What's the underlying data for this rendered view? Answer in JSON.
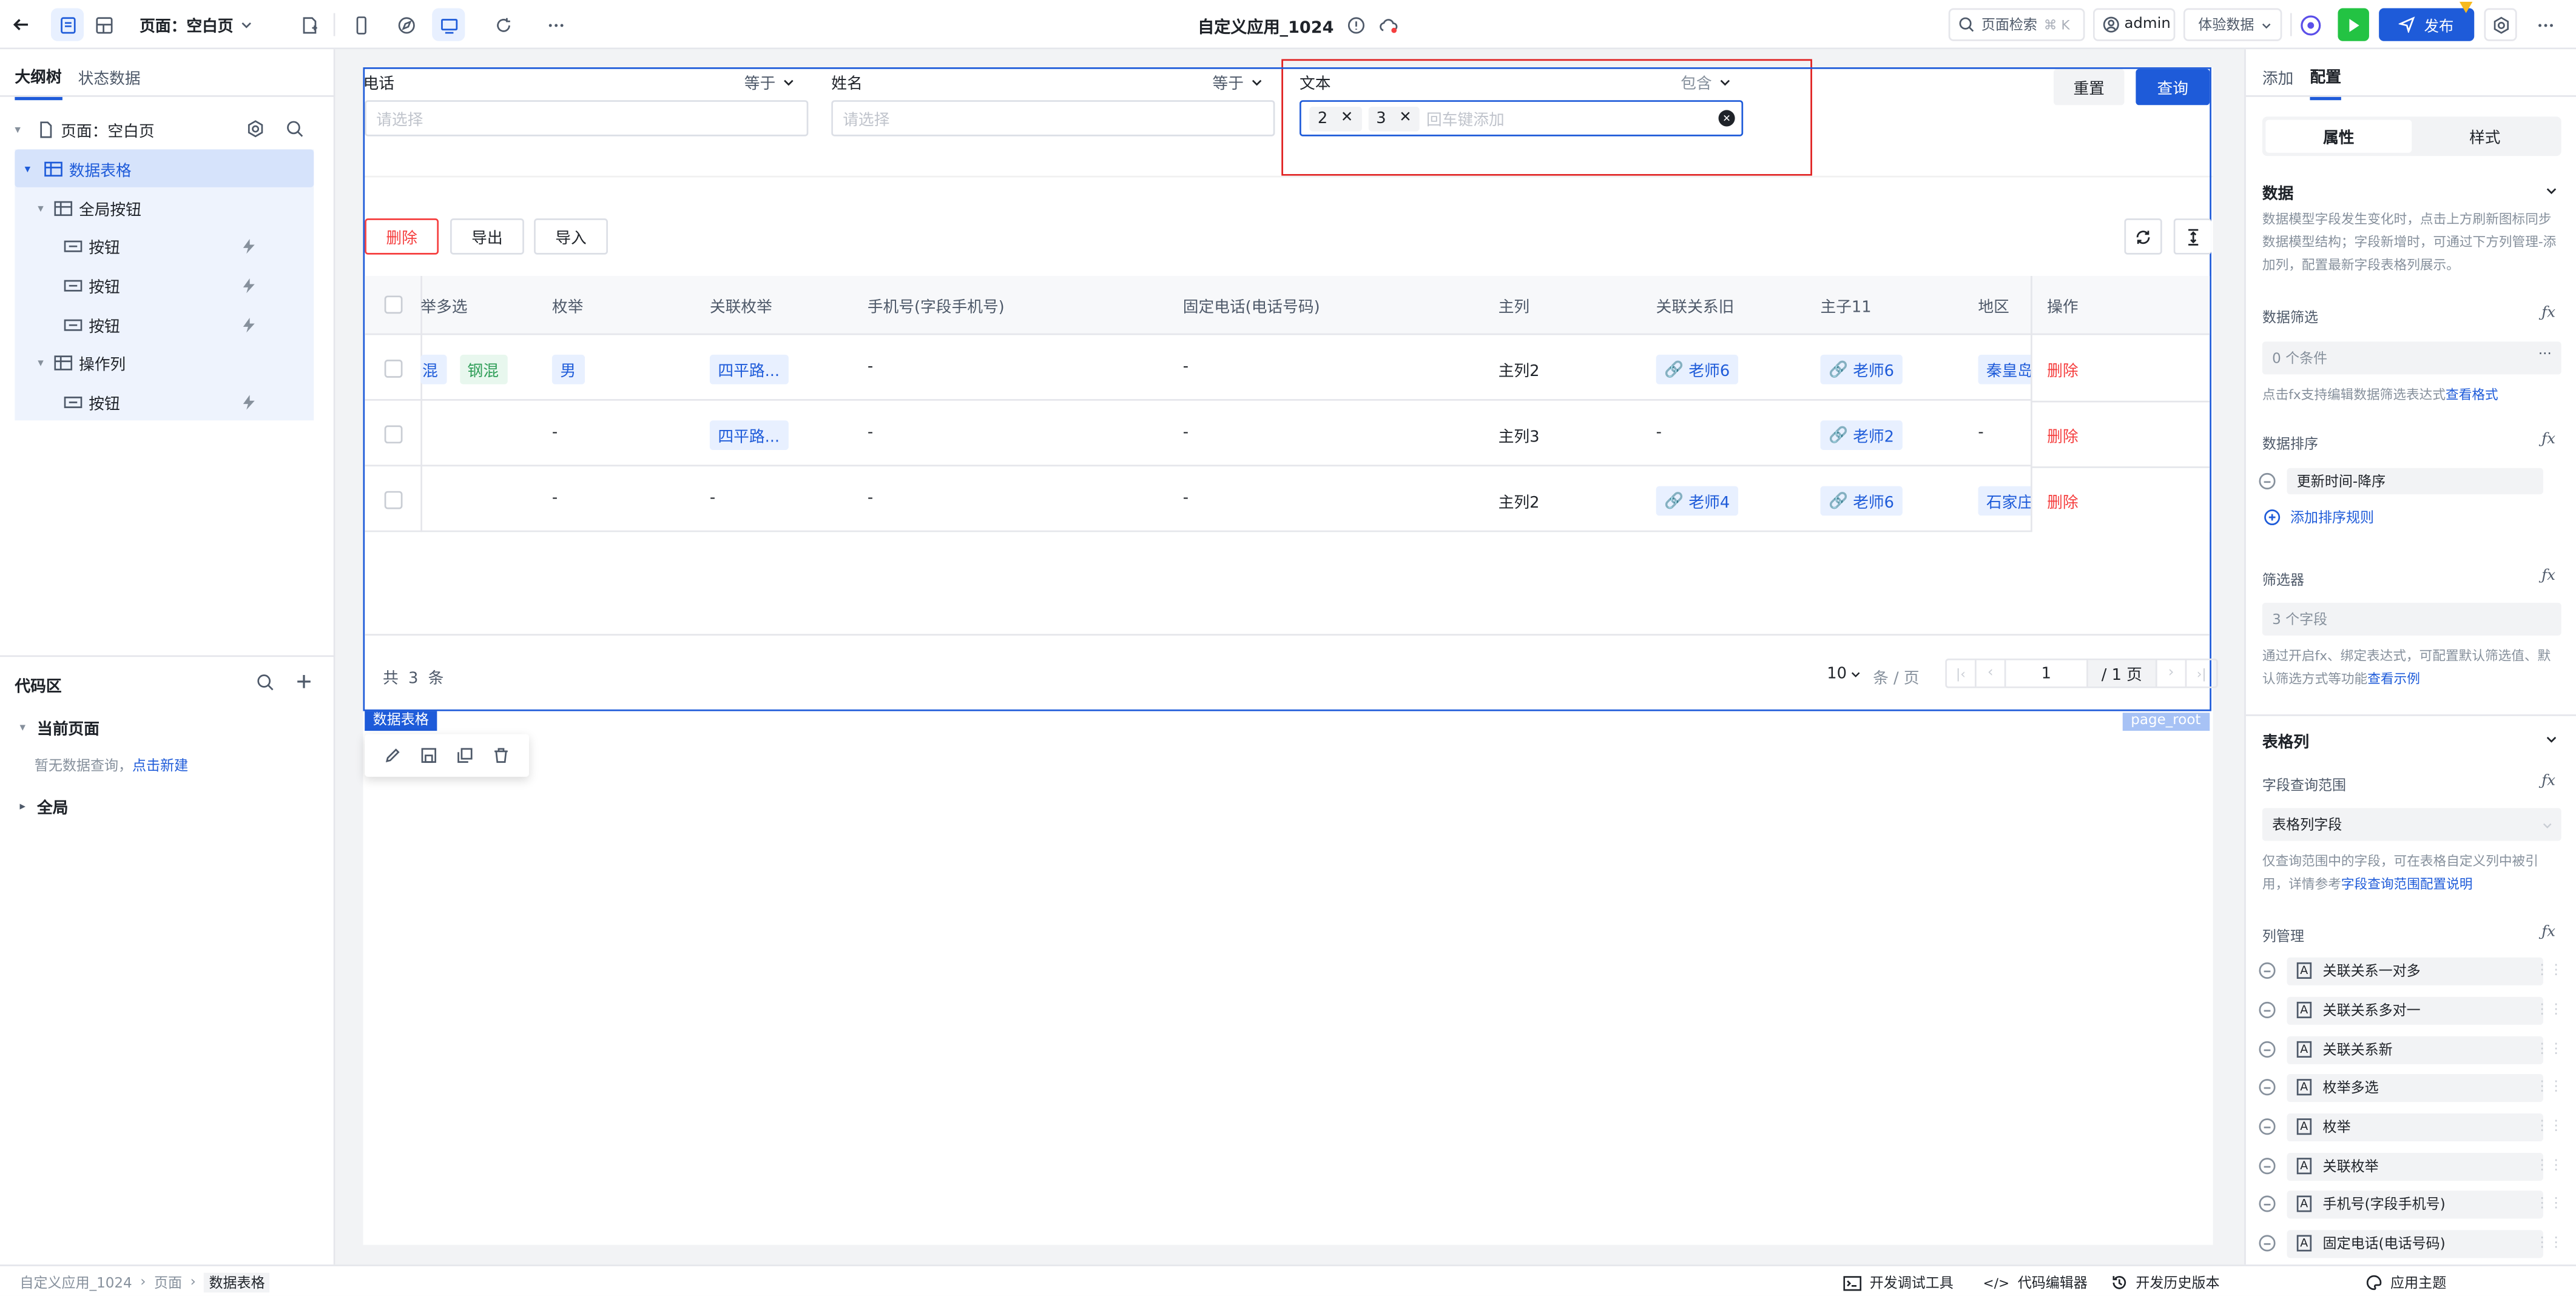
{
  "topbar": {
    "page_selector": "页面：空白页",
    "app_title": "自定义应用_1024",
    "search_label": "页面检索",
    "search_shortcut": "⌘ K",
    "user": "admin",
    "data_mode": "体验数据",
    "publish": "发布"
  },
  "left": {
    "tabs": [
      "大纲树",
      "状态数据"
    ],
    "tree": [
      {
        "label": "页面：空白页"
      },
      {
        "label": "数据表格"
      },
      {
        "label": "全局按钮"
      },
      {
        "label": "按钮"
      },
      {
        "label": "按钮"
      },
      {
        "label": "按钮"
      },
      {
        "label": "操作列"
      },
      {
        "label": "按钮"
      }
    ],
    "code_title": "代码区",
    "current_page": "当前页面",
    "no_query": "暂无数据查询，",
    "create_new": "点击新建",
    "global": "全局"
  },
  "filters": [
    {
      "label": "电话",
      "op": "等于",
      "placeholder": "请选择"
    },
    {
      "label": "姓名",
      "op": "等于",
      "placeholder": "请选择"
    },
    {
      "label": "文本",
      "op": "包含",
      "tags": [
        "2",
        "3"
      ],
      "placeholder": "回车键添加"
    }
  ],
  "actions": {
    "reset": "重置",
    "query": "查询",
    "delete": "删除",
    "export": "导出",
    "import": "导入"
  },
  "table": {
    "headers": [
      "举多选",
      "枚举",
      "关联枚举",
      "手机号(字段手机号)",
      "固定电话(电话号码)",
      "主列",
      "关联关系旧",
      "主子11",
      "地区",
      "操作"
    ],
    "rows": [
      {
        "multi": [
          "混",
          "钢混"
        ],
        "enum": "男",
        "rel_enum": "四平路...",
        "phone": "-",
        "tel": "-",
        "main": "主列2",
        "rel_old": "老师6",
        "sub11": "老师6",
        "region": "秦皇岛",
        "op": "删除"
      },
      {
        "multi": [],
        "enum": "-",
        "rel_enum": "四平路...",
        "phone": "-",
        "tel": "-",
        "main": "主列3",
        "rel_old": "-",
        "sub11": "老师2",
        "region": "-",
        "op": "删除"
      },
      {
        "multi": [],
        "enum": "-",
        "rel_enum": "-",
        "phone": "-",
        "tel": "-",
        "main": "主列2",
        "rel_old": "老师4",
        "sub11": "老师6",
        "region": "石家庄",
        "op": "删除"
      }
    ],
    "total": "共 3 条",
    "page_size": "10",
    "per_page": "条 / 页",
    "page": "1",
    "page_total": "/ 1 页",
    "component_label": "数据表格",
    "root_label": "page_root"
  },
  "right": {
    "tabs": [
      "添加",
      "配置"
    ],
    "seg": [
      "属性",
      "样式"
    ],
    "data_title": "数据",
    "data_desc": "数据模型字段发生变化时，点击上方刷新图标同步数据模型结构；字段新增时，可通过下方列管理-添加列，配置最新字段表格列展示。",
    "filter_title": "数据筛选",
    "filter_value": "0 个条件",
    "filter_desc": "点击fx支持编辑数据筛选表达式",
    "filter_link": "查看格式",
    "sort_title": "数据排序",
    "sort_item": "更新时间-降序",
    "sort_add": "添加排序规则",
    "selector_title": "筛选器",
    "selector_value": "3 个字段",
    "selector_desc": "通过开启fx、绑定表达式，可配置默认筛选值、默认筛选方式等功能",
    "selector_link": "查看示例",
    "col_title": "表格列",
    "scope_title": "字段查询范围",
    "scope_value": "表格列字段",
    "scope_desc": "仅查询范围中的字段，可在表格自定义列中被引用，详情参考",
    "scope_link": "字段查询范围配置说明",
    "colmgr_title": "列管理",
    "columns": [
      "关联关系一对多",
      "关联关系多对一",
      "关联关系新",
      "枚举多选",
      "枚举",
      "关联枚举",
      "手机号(字段手机号)",
      "固定电话(电话号码)"
    ]
  },
  "status": {
    "breadcrumb": [
      "自定义应用_1024",
      "页面",
      "数据表格"
    ],
    "tools": [
      "开发调试工具",
      "代码编辑器",
      "开发历史版本",
      "应用主题"
    ]
  }
}
